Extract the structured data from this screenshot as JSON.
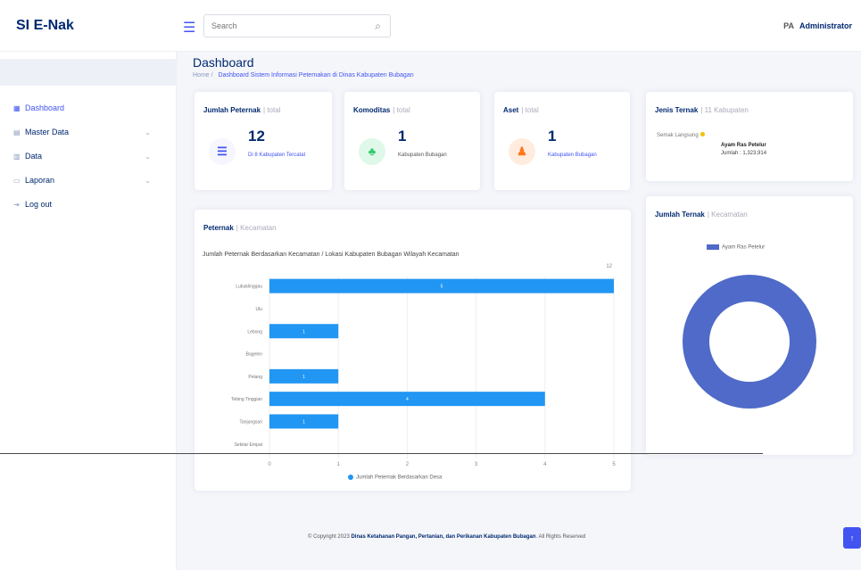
{
  "header": {
    "brand": "SI E-Nak",
    "search_placeholder": "Search",
    "user_initials": "PA",
    "user_name": "Administrator"
  },
  "sidebar": {
    "items": [
      {
        "label": "Dashboard",
        "icon": "grid-icon",
        "active": true
      },
      {
        "label": "Master Data",
        "icon": "menu-icon",
        "has_children": true
      },
      {
        "label": "Data",
        "icon": "layout-icon",
        "has_children": true
      },
      {
        "label": "Laporan",
        "icon": "file-icon",
        "has_children": true
      },
      {
        "label": "Log out",
        "icon": "logout-icon"
      }
    ]
  },
  "page": {
    "title": "Dashboard",
    "breadcrumb_home": "Home",
    "breadcrumb_current": "Dashboard Sistem Informasi Peternakan di Dinas Kabupaten Bubagan"
  },
  "stats": [
    {
      "title": "Jumlah Peternak",
      "subtitle": "| total",
      "value": "12",
      "desc": "Di 8 Kabupaten Tercatat",
      "icon": "database-icon",
      "color": "#4154f1",
      "bg": "#f6f6fe"
    },
    {
      "title": "Komoditas",
      "subtitle": "| total",
      "value": "1",
      "desc": "Kabupaten Bubagan",
      "icon": "users-icon",
      "color": "#2eca6a",
      "bg": "#e0f8e9"
    },
    {
      "title": "Aset",
      "subtitle": "| total",
      "value": "1",
      "desc": "Kabupaten Bubagan",
      "icon": "person-icon",
      "color": "#ff771d",
      "bg": "#ffecdf"
    }
  ],
  "species_card": {
    "title": "Jenis Ternak",
    "subtitle": "| 11 Kabupaten",
    "legend": "Semak Langsung",
    "tip_title": "Ayam Ras Petelur",
    "tip_value": "Jumlah : 1,323,914"
  },
  "bar_card": {
    "title": "Peternak",
    "subtitle": "| Kecamatan",
    "heading": "Jumlah Peternak Berdasarkan Kecamatan / Lokasi Kabupaten Bubagan Wilayah Kecamatan",
    "legend": "Jumlah Peternak Berdasarkan Desa"
  },
  "donut_card": {
    "title": "Jumlah Ternak",
    "subtitle": "| Kecamatan",
    "legend": "Ayam Ras Petelur"
  },
  "chart_data": [
    {
      "type": "bar",
      "orientation": "horizontal",
      "title": "Jumlah Peternak Berdasarkan Kecamatan / Lokasi Kabupaten Bubagan Wilayah Kecamatan",
      "categories": [
        "Lubuklinggau",
        "Ulu",
        "Lebong",
        "Bagelen",
        "Pelang",
        "Tebing Tinggian",
        "Tanjungsari",
        "Sekitar Empat"
      ],
      "series": [
        {
          "name": "Jumlah Peternak Berdasarkan Desa",
          "values": [
            5,
            0,
            1,
            0,
            1,
            4,
            1,
            0
          ]
        }
      ],
      "xticks": [
        0,
        1,
        2,
        3,
        4,
        5
      ],
      "xlim": [
        0,
        5
      ],
      "total_label": "12",
      "grid": true,
      "color": "#2196f3"
    },
    {
      "type": "pie",
      "style": "donut",
      "labels": [
        "Ayam Ras Petelur"
      ],
      "values": [
        1
      ],
      "colors": [
        "#4f6ac8"
      ],
      "legend": "top"
    }
  ],
  "footer": {
    "copyright": "© Copyright 2023",
    "org": "Dinas Ketahanan Pangan, Pertanian, dan Perikanan Kabupaten Bubagan",
    "rights": ". All Rights Reserved"
  },
  "back_to_top": "↑"
}
